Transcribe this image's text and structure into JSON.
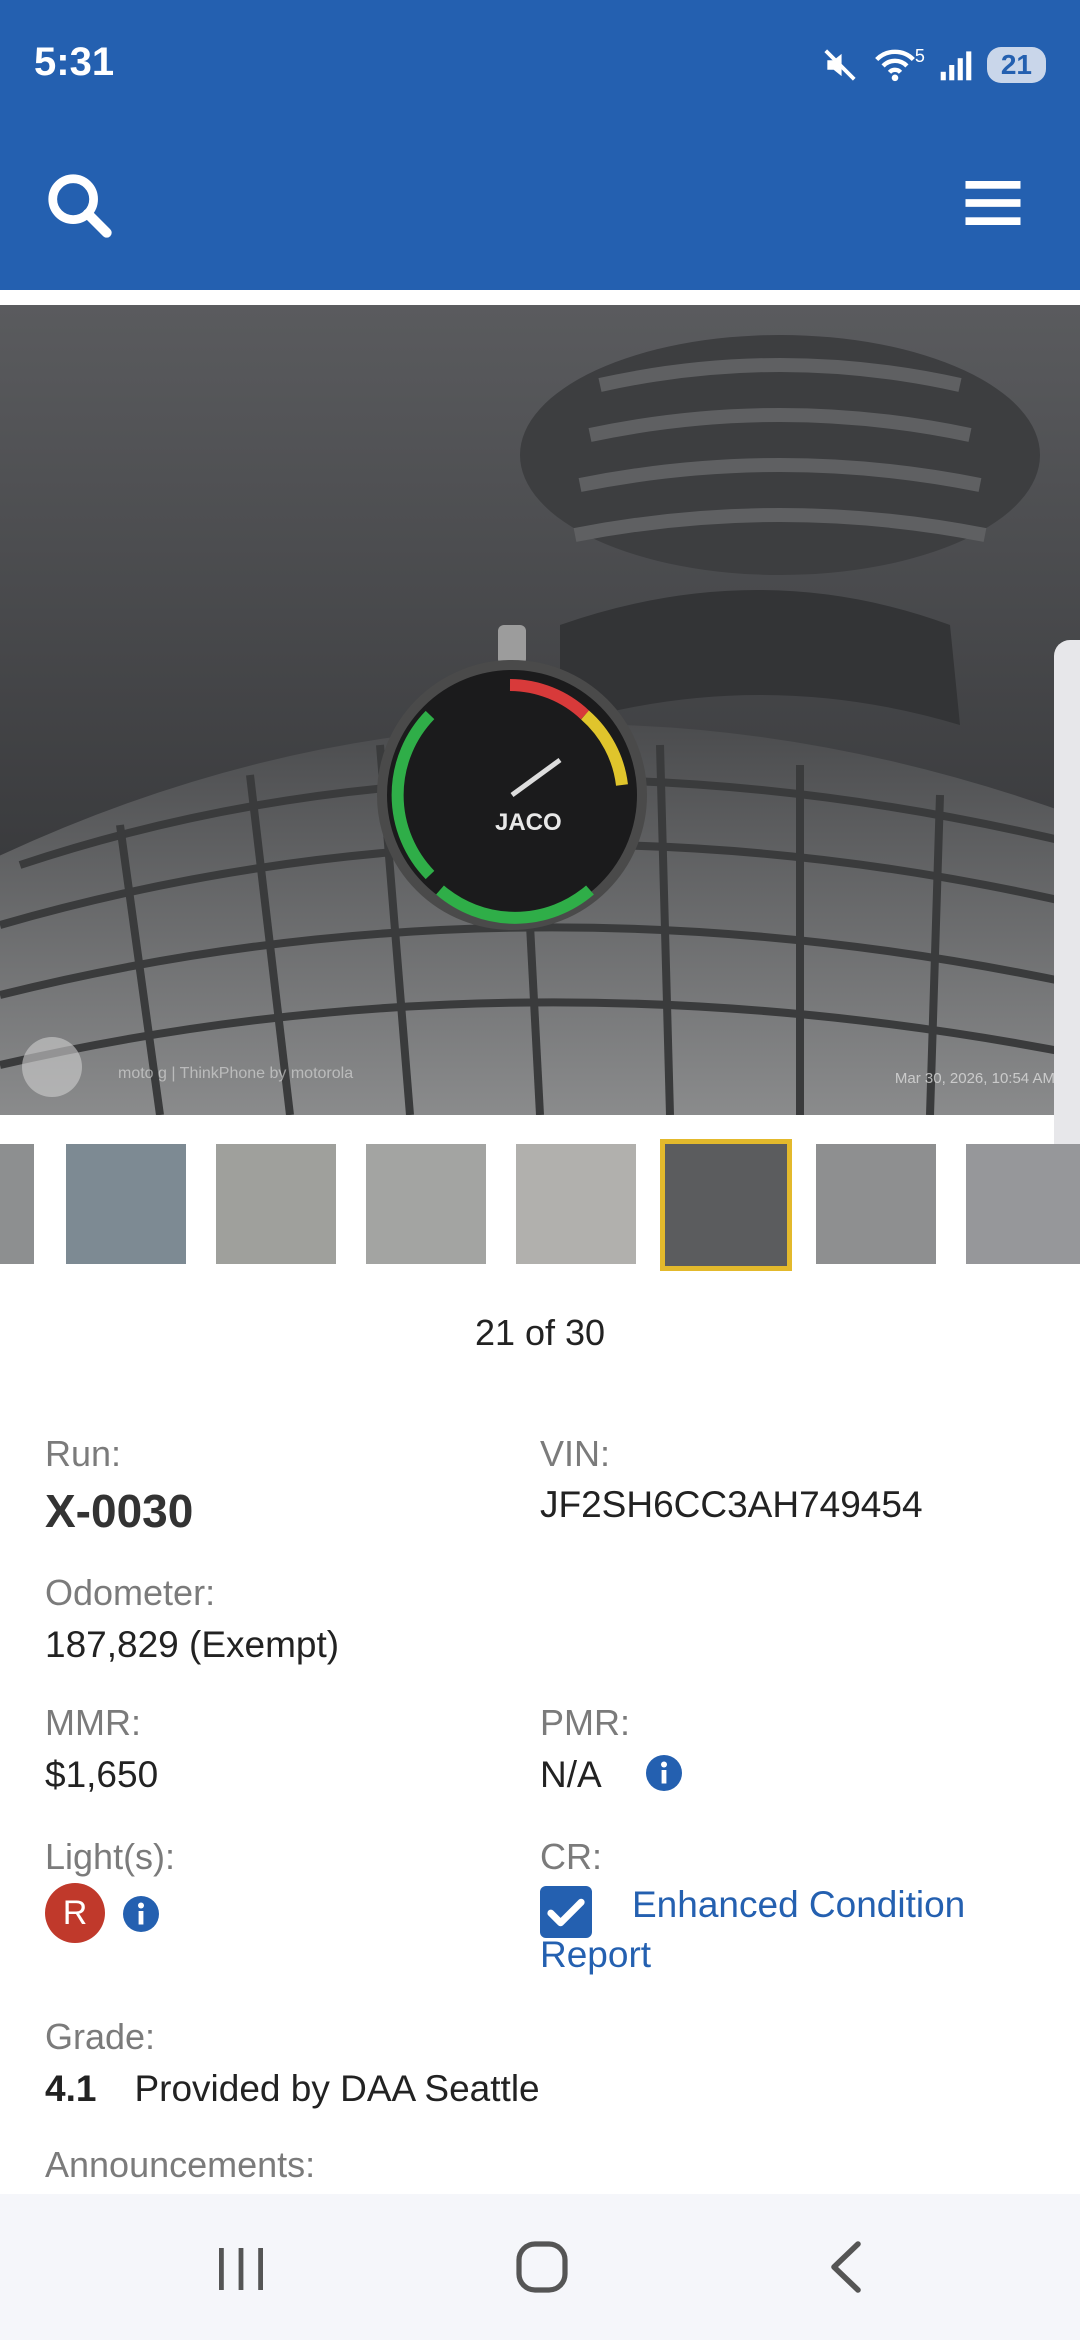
{
  "status_bar": {
    "time": "5:31",
    "wifi_badge": "5",
    "battery": "21"
  },
  "app_bar": {
    "search_icon": "search-icon",
    "menu_icon": "hamburger-menu-icon",
    "color": "#2460b0"
  },
  "photo": {
    "description_icon": "tire-tread-depth-gauge-photo",
    "watermark_left": "moto g | ThinkPhone by motorola",
    "watermark_right": "Mar 30, 2026, 10:54 AM"
  },
  "gallery": {
    "counter": "21 of 30",
    "active_index": 5,
    "thumb_count": 8
  },
  "details": {
    "run_label": "Run:",
    "run_value": "X-0030",
    "vin_label": "VIN:",
    "vin_value": "JF2SH6CC3AH749454",
    "odometer_label": "Odometer:",
    "odometer_value": "187,829 (Exempt)",
    "mmr_label": "MMR:",
    "mmr_value": "$1,650",
    "pmr_label": "PMR:",
    "pmr_value": "N/A",
    "lights_label": "Light(s):",
    "lights_value": "R",
    "cr_label": "CR:",
    "cr_link": "Enhanced Condition Report",
    "grade_label": "Grade:",
    "grade_value": "4.1",
    "grade_provider": "Provided by DAA Seattle",
    "announcements_label": "Announcements:"
  },
  "colors": {
    "accent": "#2460b0",
    "light_red": "#c0392b",
    "active_thumb": "#e3b92c"
  }
}
